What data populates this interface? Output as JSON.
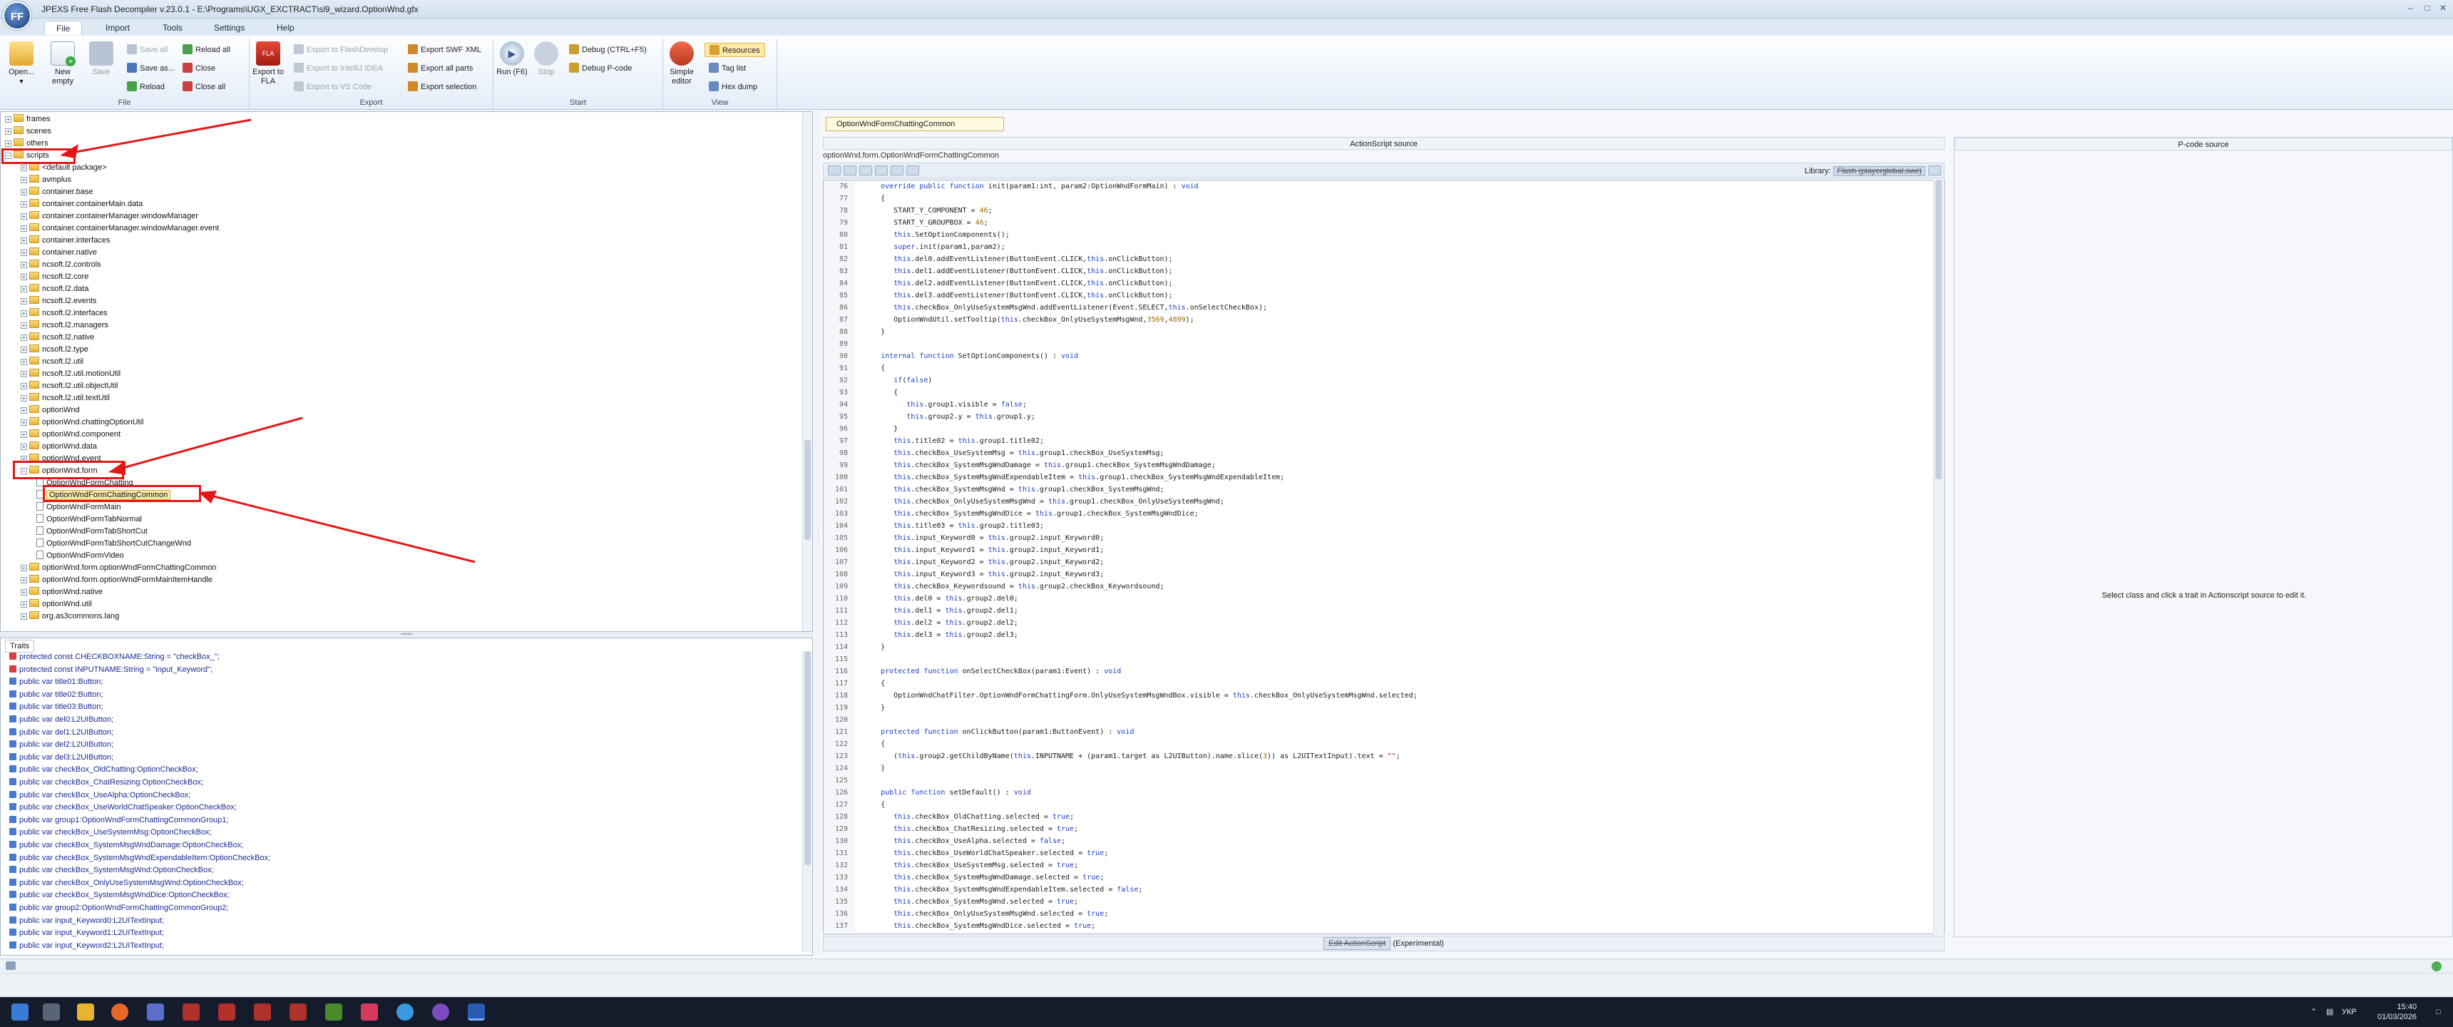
{
  "window": {
    "title": "JPEXS Free Flash Decompiler v.23.0.1 - E:\\Programs\\UGX_EXCTRACT\\sl9_wizard.OptionWnd.gfx",
    "logo_text": "FF"
  },
  "menu": [
    "File",
    "Import",
    "Tools",
    "Settings",
    "Help"
  ],
  "ribbon": {
    "file_group": "File",
    "export_group": "Export",
    "start_group": "Start",
    "view_group": "View",
    "open": "Open...",
    "new_empty": "New empty",
    "save": "Save",
    "save_all": "Save all",
    "save_as": "Save as...",
    "reload_small": "Reload",
    "reload_all": "Reload all",
    "close": "Close",
    "close_all": "Close all",
    "export_to_fla": "Export to FLA",
    "export_to_flashdevelop": "Export to FlashDevelop",
    "export_to_intellij": "Export to IntelliJ IDEA",
    "export_to_vscode": "Export to VS Code",
    "export_swf_xml": "Export SWF XML",
    "export_all_parts": "Export all parts",
    "export_selection": "Export selection",
    "run": "Run (F6)",
    "stop": "Stop",
    "debug": "Debug (CTRL+F5)",
    "debug_pcode": "Debug P-code",
    "simple_editor": "Simple editor",
    "resources": "Resources",
    "tag_list": "Tag list",
    "hex_dump": "Hex dump"
  },
  "tree": [
    {
      "label": "frames",
      "indent": 0,
      "kind": "folder"
    },
    {
      "label": "scenes",
      "indent": 0,
      "kind": "folder"
    },
    {
      "label": "others",
      "indent": 0,
      "kind": "folder"
    },
    {
      "label": "scripts",
      "indent": 0,
      "kind": "folder",
      "expanded": true
    },
    {
      "label": "<default package>",
      "indent": 1,
      "kind": "folder"
    },
    {
      "label": "avmplus",
      "indent": 1,
      "kind": "folder"
    },
    {
      "label": "container.base",
      "indent": 1,
      "kind": "folder"
    },
    {
      "label": "container.containerMain.data",
      "indent": 1,
      "kind": "folder"
    },
    {
      "label": "container.containerManager.windowManager",
      "indent": 1,
      "kind": "folder"
    },
    {
      "label": "container.containerManager.windowManager.event",
      "indent": 1,
      "kind": "folder"
    },
    {
      "label": "container.interfaces",
      "indent": 1,
      "kind": "folder"
    },
    {
      "label": "container.native",
      "indent": 1,
      "kind": "folder"
    },
    {
      "label": "ncsoft.l2.controls",
      "indent": 1,
      "kind": "folder"
    },
    {
      "label": "ncsoft.l2.core",
      "indent": 1,
      "kind": "folder"
    },
    {
      "label": "ncsoft.l2.data",
      "indent": 1,
      "kind": "folder"
    },
    {
      "label": "ncsoft.l2.events",
      "indent": 1,
      "kind": "folder"
    },
    {
      "label": "ncsoft.l2.interfaces",
      "indent": 1,
      "kind": "folder"
    },
    {
      "label": "ncsoft.l2.managers",
      "indent": 1,
      "kind": "folder"
    },
    {
      "label": "ncsoft.l2.native",
      "indent": 1,
      "kind": "folder"
    },
    {
      "label": "ncsoft.l2.type",
      "indent": 1,
      "kind": "folder"
    },
    {
      "label": "ncsoft.l2.util",
      "indent": 1,
      "kind": "folder"
    },
    {
      "label": "ncsoft.l2.util.motionUtil",
      "indent": 1,
      "kind": "folder"
    },
    {
      "label": "ncsoft.l2.util.objectUtil",
      "indent": 1,
      "kind": "folder"
    },
    {
      "label": "ncsoft.l2.util.textUtil",
      "indent": 1,
      "kind": "folder"
    },
    {
      "label": "optionWnd",
      "indent": 1,
      "kind": "folder"
    },
    {
      "label": "optionWnd.chattingOptionUtil",
      "indent": 1,
      "kind": "folder"
    },
    {
      "label": "optionWnd.component",
      "indent": 1,
      "kind": "folder"
    },
    {
      "label": "optionWnd.data",
      "indent": 1,
      "kind": "folder"
    },
    {
      "label": "optionWnd.event",
      "indent": 1,
      "kind": "folder"
    },
    {
      "label": "optionWnd.form",
      "indent": 1,
      "kind": "folder",
      "expanded": true
    },
    {
      "label": "OptionWndFormChatting",
      "indent": 2,
      "kind": "file"
    },
    {
      "label": "OptionWndFormChattingCommon",
      "indent": 2,
      "kind": "file",
      "selected": true
    },
    {
      "label": "OptionWndFormMain",
      "indent": 2,
      "kind": "file"
    },
    {
      "label": "OptionWndFormTabNormal",
      "indent": 2,
      "kind": "file"
    },
    {
      "label": "OptionWndFormTabShortCut",
      "indent": 2,
      "kind": "file"
    },
    {
      "label": "OptionWndFormTabShortCutChangeWnd",
      "indent": 2,
      "kind": "file"
    },
    {
      "label": "OptionWndFormVideo",
      "indent": 2,
      "kind": "file"
    },
    {
      "label": "optionWnd.form.optionWndFormChattingCommon",
      "indent": 1,
      "kind": "folder"
    },
    {
      "label": "optionWnd.form.optionWndFormMainItemHandle",
      "indent": 1,
      "kind": "folder"
    },
    {
      "label": "optionWnd.native",
      "indent": 1,
      "kind": "folder"
    },
    {
      "label": "optionWnd.util",
      "indent": 1,
      "kind": "folder"
    },
    {
      "label": "org.as3commons.lang",
      "indent": 1,
      "kind": "folder"
    }
  ],
  "traits_tab": "Traits",
  "traits": [
    {
      "text": "protected const CHECKBOXNAME:String = \"checkBox_\";",
      "kind": "const"
    },
    {
      "text": "protected const INPUTNAME:String = \"input_Keyword\";",
      "kind": "const"
    },
    {
      "text": "public var title01:Button;",
      "kind": "var"
    },
    {
      "text": "public var title02:Button;",
      "kind": "var"
    },
    {
      "text": "public var title03:Button;",
      "kind": "var"
    },
    {
      "text": "public var del0:L2UIButton;",
      "kind": "var"
    },
    {
      "text": "public var del1:L2UIButton;",
      "kind": "var"
    },
    {
      "text": "public var del2:L2UIButton;",
      "kind": "var"
    },
    {
      "text": "public var del3:L2UIButton;",
      "kind": "var"
    },
    {
      "text": "public var checkBox_OldChatting:OptionCheckBox;",
      "kind": "var"
    },
    {
      "text": "public var checkBox_ChatResizing:OptionCheckBox;",
      "kind": "var"
    },
    {
      "text": "public var checkBox_UseAlpha:OptionCheckBox;",
      "kind": "var"
    },
    {
      "text": "public var checkBox_UseWorldChatSpeaker:OptionCheckBox;",
      "kind": "var"
    },
    {
      "text": "public var group1:OptionWndFormChattingCommonGroup1;",
      "kind": "var"
    },
    {
      "text": "public var checkBox_UseSystemMsg:OptionCheckBox;",
      "kind": "var"
    },
    {
      "text": "public var checkBox_SystemMsgWndDamage:OptionCheckBox;",
      "kind": "var"
    },
    {
      "text": "public var checkBox_SystemMsgWndExpendableItem:OptionCheckBox;",
      "kind": "var"
    },
    {
      "text": "public var checkBox_SystemMsgWnd:OptionCheckBox;",
      "kind": "var"
    },
    {
      "text": "public var checkBox_OnlyUseSystemMsgWnd:OptionCheckBox;",
      "kind": "var"
    },
    {
      "text": "public var checkBox_SystemMsgWndDice:OptionCheckBox;",
      "kind": "var"
    },
    {
      "text": "public var group2:OptionWndFormChattingCommonGroup2;",
      "kind": "var"
    },
    {
      "text": "public var input_Keyword0:L2UITextInput;",
      "kind": "var"
    },
    {
      "text": "public var input_Keyword1:L2UITextInput;",
      "kind": "var"
    },
    {
      "text": "public var input_Keyword2:L2UITextInput;",
      "kind": "var"
    }
  ],
  "document_tab": "OptionWndFormChattingCommon",
  "actionscript_header": "ActionScript source",
  "pcode_header": "P-code source",
  "package_path": "optionWnd.form.OptionWndFormChattingCommon",
  "library_label": "Library:",
  "library_value": "Flash (playerglobal.swc)",
  "code_lines": [
    {
      "n": 76,
      "t": "      override public function init(param1:int, param2:OptionWndFormMain) : void"
    },
    {
      "n": 77,
      "t": "      {"
    },
    {
      "n": 78,
      "t": "         START_Y_COMPONENT = 46;"
    },
    {
      "n": 79,
      "t": "         START_Y_GROUPBOX = 46;"
    },
    {
      "n": 80,
      "t": "         this.SetOptionComponents();"
    },
    {
      "n": 81,
      "t": "         super.init(param1,param2);"
    },
    {
      "n": 82,
      "t": "         this.del0.addEventListener(ButtonEvent.CLICK,this.onClickButton);"
    },
    {
      "n": 83,
      "t": "         this.del1.addEventListener(ButtonEvent.CLICK,this.onClickButton);"
    },
    {
      "n": 84,
      "t": "         this.del2.addEventListener(ButtonEvent.CLICK,this.onClickButton);"
    },
    {
      "n": 85,
      "t": "         this.del3.addEventListener(ButtonEvent.CLICK,this.onClickButton);"
    },
    {
      "n": 86,
      "t": "         this.checkBox_OnlyUseSystemMsgWnd.addEventListener(Event.SELECT,this.onSelectCheckBox);"
    },
    {
      "n": 87,
      "t": "         OptionWndUtil.setTooltip(this.checkBox_OnlyUseSystemMsgWnd,3569,4899);"
    },
    {
      "n": 88,
      "t": "      }"
    },
    {
      "n": 89,
      "t": ""
    },
    {
      "n": 90,
      "t": "      internal function SetOptionComponents() : void"
    },
    {
      "n": 91,
      "t": "      {"
    },
    {
      "n": 92,
      "t": "         if(false)"
    },
    {
      "n": 93,
      "t": "         {"
    },
    {
      "n": 94,
      "t": "            this.group1.visible = false;"
    },
    {
      "n": 95,
      "t": "            this.group2.y = this.group1.y;"
    },
    {
      "n": 96,
      "t": "         }"
    },
    {
      "n": 97,
      "t": "         this.title02 = this.group1.title02;"
    },
    {
      "n": 98,
      "t": "         this.checkBox_UseSystemMsg = this.group1.checkBox_UseSystemMsg;"
    },
    {
      "n": 99,
      "t": "         this.checkBox_SystemMsgWndDamage = this.group1.checkBox_SystemMsgWndDamage;"
    },
    {
      "n": 100,
      "t": "         this.checkBox_SystemMsgWndExpendableItem = this.group1.checkBox_SystemMsgWndExpendableItem;"
    },
    {
      "n": 101,
      "t": "         this.checkBox_SystemMsgWnd = this.group1.checkBox_SystemMsgWnd;"
    },
    {
      "n": 102,
      "t": "         this.checkBox_OnlyUseSystemMsgWnd = this.group1.checkBox_OnlyUseSystemMsgWnd;"
    },
    {
      "n": 103,
      "t": "         this.checkBox_SystemMsgWndDice = this.group1.checkBox_SystemMsgWndDice;"
    },
    {
      "n": 104,
      "t": "         this.title03 = this.group2.title03;"
    },
    {
      "n": 105,
      "t": "         this.input_Keyword0 = this.group2.input_Keyword0;"
    },
    {
      "n": 106,
      "t": "         this.input_Keyword1 = this.group2.input_Keyword1;"
    },
    {
      "n": 107,
      "t": "         this.input_Keyword2 = this.group2.input_Keyword2;"
    },
    {
      "n": 108,
      "t": "         this.input_Keyword3 = this.group2.input_Keyword3;"
    },
    {
      "n": 109,
      "t": "         this.checkBox_Keywordsound = this.group2.checkBox_Keywordsound;"
    },
    {
      "n": 110,
      "t": "         this.del0 = this.group2.del0;"
    },
    {
      "n": 111,
      "t": "         this.del1 = this.group2.del1;"
    },
    {
      "n": 112,
      "t": "         this.del2 = this.group2.del2;"
    },
    {
      "n": 113,
      "t": "         this.del3 = this.group2.del3;"
    },
    {
      "n": 114,
      "t": "      }"
    },
    {
      "n": 115,
      "t": ""
    },
    {
      "n": 116,
      "t": "      protected function onSelectCheckBox(param1:Event) : void"
    },
    {
      "n": 117,
      "t": "      {"
    },
    {
      "n": 118,
      "t": "         OptionWndChatFilter.OptionWndFormChattingForm.OnlyUseSystemMsgWndBox.visible = this.checkBox_OnlyUseSystemMsgWnd.selected;"
    },
    {
      "n": 119,
      "t": "      }"
    },
    {
      "n": 120,
      "t": ""
    },
    {
      "n": 121,
      "t": "      protected function onClickButton(param1:ButtonEvent) : void"
    },
    {
      "n": 122,
      "t": "      {"
    },
    {
      "n": 123,
      "t": "         (this.group2.getChildByName(this.INPUTNAME + (param1.target as L2UIButton).name.slice(3)) as L2UITextInput).text = \"\";"
    },
    {
      "n": 124,
      "t": "      }"
    },
    {
      "n": 125,
      "t": ""
    },
    {
      "n": 126,
      "t": "      public function setDefault() : void"
    },
    {
      "n": 127,
      "t": "      {"
    },
    {
      "n": 128,
      "t": "         this.checkBox_OldChatting.selected = true;"
    },
    {
      "n": 129,
      "t": "         this.checkBox_ChatResizing.selected = true;"
    },
    {
      "n": 130,
      "t": "         this.checkBox_UseAlpha.selected = false;"
    },
    {
      "n": 131,
      "t": "         this.checkBox_UseWorldChatSpeaker.selected = true;"
    },
    {
      "n": 132,
      "t": "         this.checkBox_UseSystemMsg.selected = true;"
    },
    {
      "n": 133,
      "t": "         this.checkBox_SystemMsgWndDamage.selected = true;"
    },
    {
      "n": 134,
      "t": "         this.checkBox_SystemMsgWndExpendableItem.selected = false;"
    },
    {
      "n": 135,
      "t": "         this.checkBox_SystemMsgWnd.selected = true;"
    },
    {
      "n": 136,
      "t": "         this.checkBox_OnlyUseSystemMsgWnd.selected = true;"
    },
    {
      "n": 137,
      "t": "         this.checkBox_SystemMsgWndDice.selected = true;"
    }
  ],
  "edit_actionscript": "Edit ActionScript",
  "experimental": "(Experimental)",
  "pcode_hint": "Select class and click a trait in Actionscript source to edit it.",
  "taskbar": {
    "lang": "УКР",
    "time": "15:40",
    "date": "01/03/2026"
  },
  "colors": {
    "highlight_red": "#e21818",
    "selection": "#fde9a8",
    "keyword": "#1f3fbf"
  }
}
